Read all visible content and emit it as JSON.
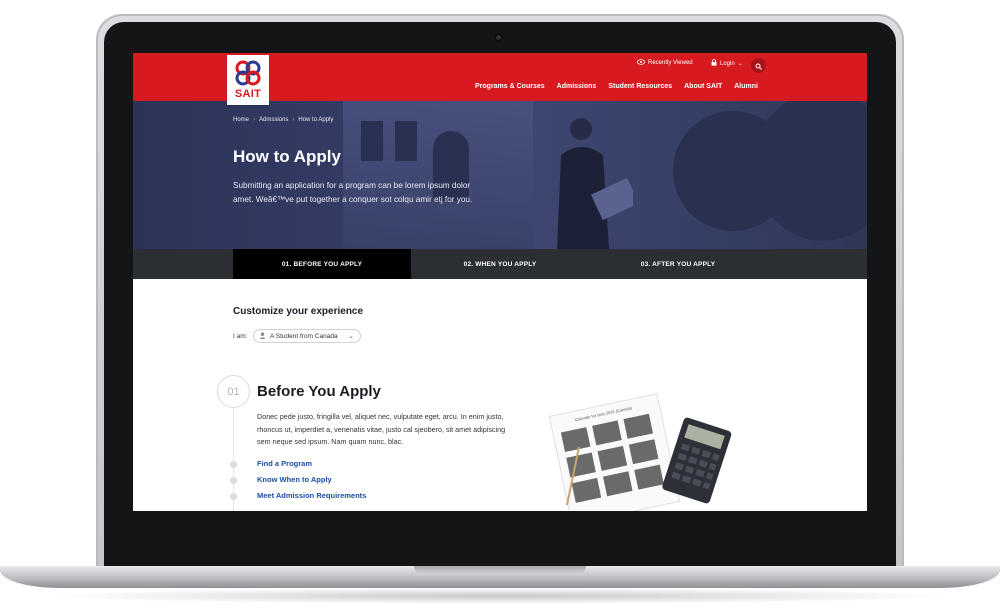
{
  "header": {
    "logo_text": "SAIT",
    "recently_viewed": "Recently Viewed",
    "login": "Login",
    "nav": [
      "Programs & Courses",
      "Admissions",
      "Student Resources",
      "About SAIT",
      "Alumni"
    ]
  },
  "breadcrumb": [
    "Home",
    "Admssions",
    "How to Apply"
  ],
  "hero": {
    "title": "How to Apply",
    "body": "Submitting an application for a program can be lorem ipsum dolor amet. Weâ€™ve put together a conquer sot colqu amir etj for you."
  },
  "tabs": [
    "01. BEFORE YOU APPLY",
    "02. WHEN YOU APPLY",
    "03. AFTER YOU APPLY"
  ],
  "customize": {
    "title": "Customize your experience",
    "iam_label": "I am:",
    "selected": "A Student from Canada"
  },
  "section": {
    "number": "01",
    "title": "Before You Apply",
    "body": "Donec pede justo, fringilla vel, aliquet nec, vulputate eget, arcu. In enim justo, rhoncus ut, imperdiet a, venenatis vitae, justo cal sjeobero, sit amet adipiscing sem neque sed ipsum. Nam quam nunc, blac.",
    "links": [
      "Find a Program",
      "Know When to Apply",
      "Meet Admission Requirements"
    ]
  },
  "calendar_caption": "Calendar for year 2016 (Canada)",
  "colors": {
    "brand_red": "#d71920",
    "link_blue": "#1a4fa6",
    "hero_navy": "#353d66",
    "tab_bar": "#2b2e33"
  }
}
